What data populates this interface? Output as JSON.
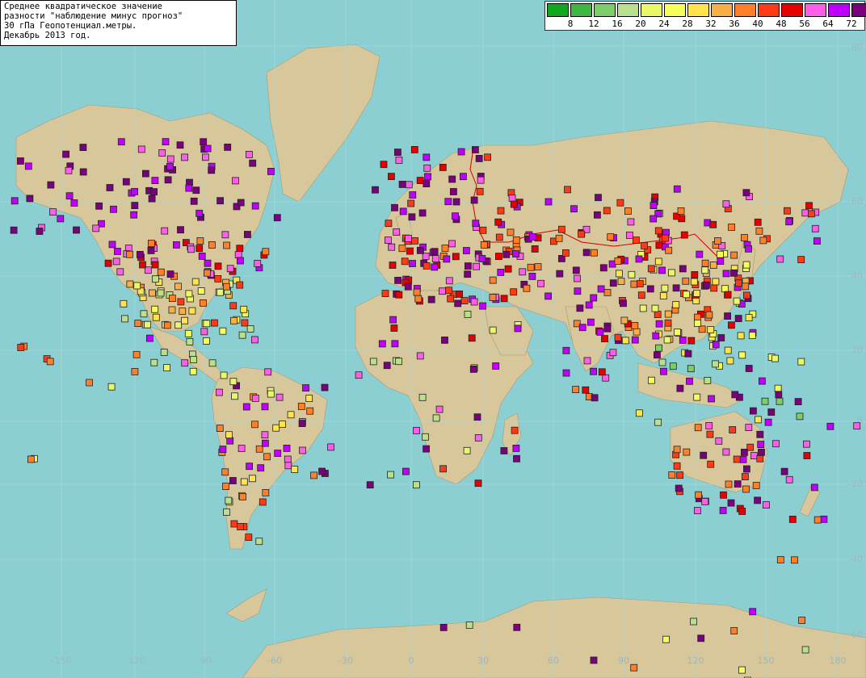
{
  "title_lines": [
    "Среднее квадратическое значение",
    "разности \"наблюдение минус прогноз\"",
    "30 гПа Геопотенциал.метры.",
    "Декабрь 2013 год."
  ],
  "legend": {
    "colors": [
      "#13a61f",
      "#3fb83f",
      "#7fcc6a",
      "#b9e08c",
      "#e9f769",
      "#f6ff5a",
      "#ffe44d",
      "#f8b046",
      "#ff7f2a",
      "#ff3a14",
      "#e70000",
      "#ff5fe8",
      "#c000ff",
      "#7a007f"
    ],
    "labels": [
      "8",
      "12",
      "16",
      "20",
      "24",
      "28",
      "32",
      "36",
      "40",
      "48",
      "56",
      "64",
      "72"
    ]
  },
  "axes": {
    "lon_labels": [
      "-150",
      "-120",
      "-90",
      "-60",
      "-30",
      "0",
      "30",
      "60",
      "90",
      "120",
      "150",
      "180"
    ],
    "lat_labels": [
      "80",
      "60",
      "40",
      "20",
      "0",
      "-20",
      "-40",
      "-60"
    ]
  }
}
